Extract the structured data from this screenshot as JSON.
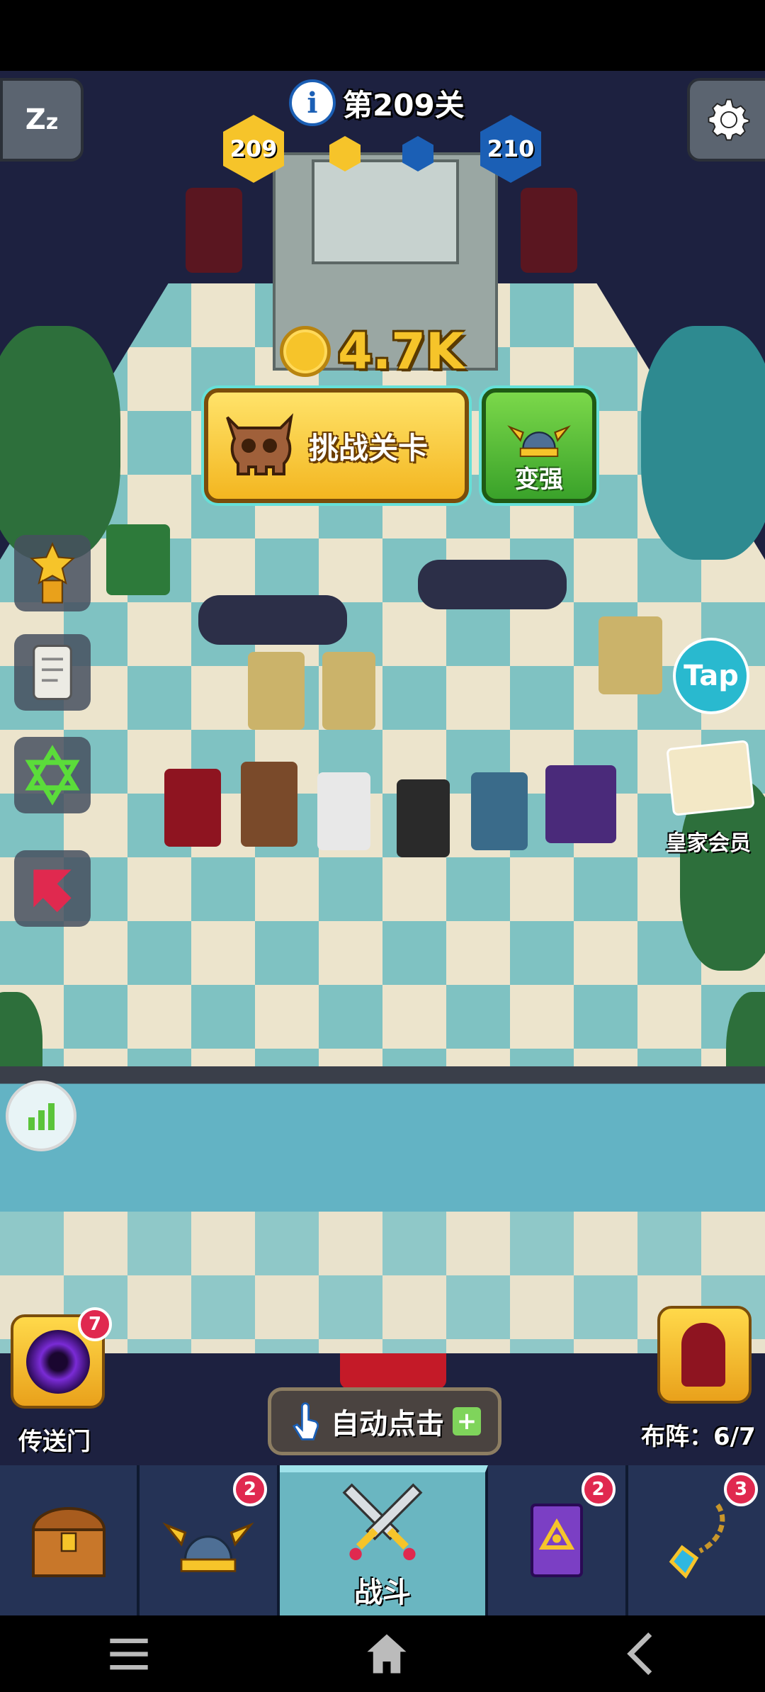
{
  "hud": {
    "level_title": "第209关",
    "info_icon": "info-icon",
    "sleep_icon": "zzz-icon",
    "settings_icon": "gear-icon",
    "current_level": "209",
    "next_level": "210",
    "coin_reward": "4.7K"
  },
  "actions": {
    "challenge_label": "挑战关卡",
    "upgrade_label": "变强",
    "tap_label": "Tap",
    "vip_label": "皇家会员",
    "auto_click_label": "自动点击",
    "auto_click_plus": "+"
  },
  "left_panel": {
    "portal_label": "传送门",
    "portal_badge": "7",
    "formation_label": "布阵：6/7"
  },
  "tabs": [
    {
      "name": "chest",
      "icon": "treasure-chest-icon",
      "badge": ""
    },
    {
      "name": "heroes",
      "icon": "winged-helmet-icon",
      "badge": "2"
    },
    {
      "name": "battle",
      "icon": "crossed-swords-icon",
      "label": "战斗",
      "badge": ""
    },
    {
      "name": "spellbook",
      "icon": "spellbook-icon",
      "badge": "2"
    },
    {
      "name": "amulet",
      "icon": "amulet-icon",
      "badge": "3"
    }
  ],
  "system_nav": {
    "menu_icon": "menu-icon",
    "home_icon": "home-icon",
    "back_icon": "back-icon"
  },
  "colors": {
    "gold": "#f6c42a",
    "accent_blue": "#29b9cf",
    "badge_red": "#e0294f",
    "tab_bg": "#253356"
  }
}
